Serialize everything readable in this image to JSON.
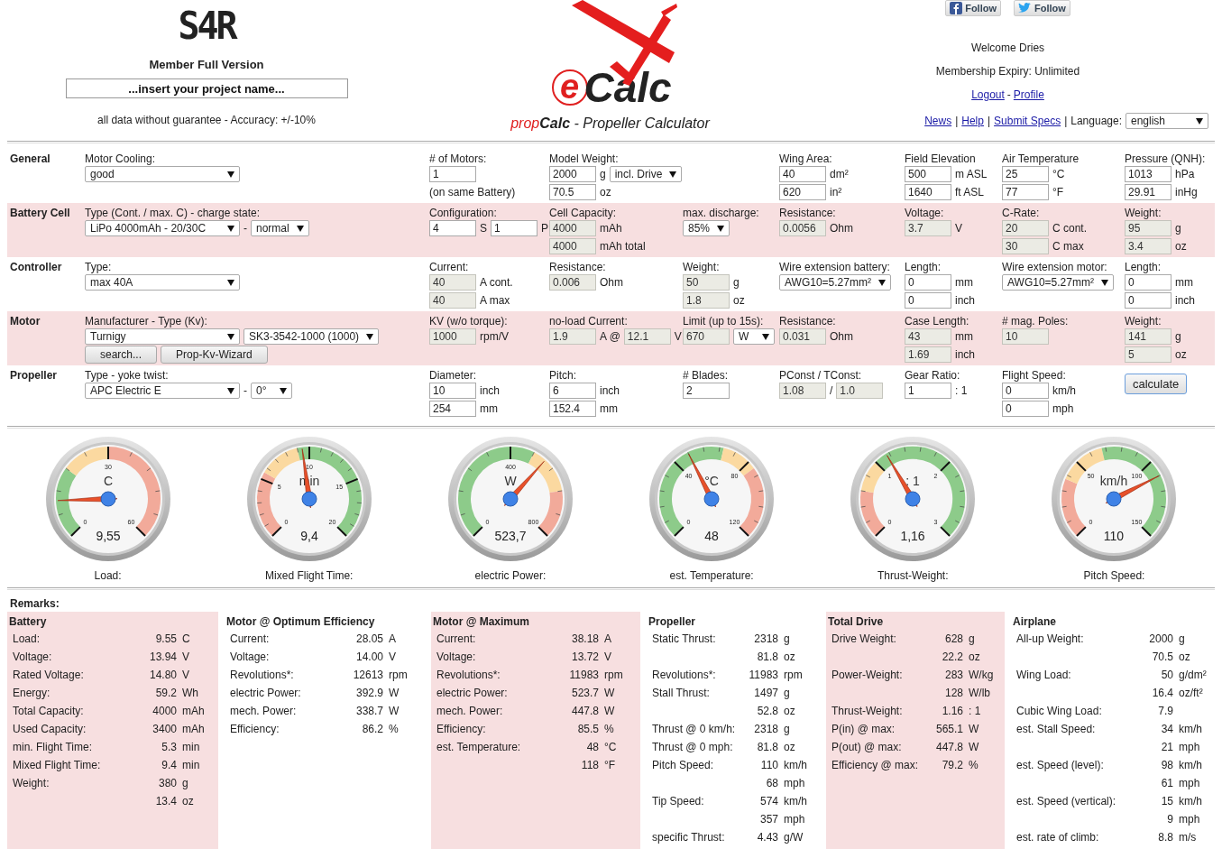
{
  "header": {
    "badge": "S4R",
    "edition": "Member Full Version",
    "project_name": {
      "value": "...insert your project name..."
    },
    "disclaimer": "all data without guarantee - Accuracy: +/-10%",
    "logo": {
      "letter": "e",
      "word": "Calc"
    },
    "subtitle": {
      "prefix": "prop",
      "brand": "Calc",
      "rest": " - Propeller Calculator"
    },
    "social": [
      {
        "kind": "facebook",
        "label": "Follow"
      },
      {
        "kind": "twitter",
        "label": "Follow"
      }
    ],
    "welcome": "Welcome Dries",
    "membership": "Membership Expiry: Unlimited",
    "account_links": [
      {
        "label": "Logout",
        "separator": "-"
      },
      {
        "label": "Profile"
      }
    ],
    "nav_links": [
      {
        "label": "News",
        "separator": "|"
      },
      {
        "label": "Help",
        "separator": "|"
      },
      {
        "label": "Submit Specs",
        "separator": "|"
      }
    ],
    "language": {
      "label": "Language:",
      "value": "english"
    }
  },
  "form": {
    "sections": [
      {
        "title": "General",
        "shaded": false,
        "fields": [
          {
            "label": "Motor Cooling:",
            "lines": [
              [
                {
                  "kind": "select",
                  "value": "good"
                }
              ]
            ]
          },
          {
            "label": "# of Motors:",
            "lines": [
              [
                {
                  "kind": "input",
                  "value": "1",
                  "readonly": false
                }
              ],
              [
                {
                  "kind": "note",
                  "text": "(on same Battery)"
                }
              ]
            ]
          },
          {
            "label": "Model Weight:",
            "lines": [
              [
                {
                  "kind": "input",
                  "value": "2000",
                  "readonly": false
                },
                {
                  "kind": "unit",
                  "text": "g"
                },
                {
                  "kind": "select",
                  "value": "incl. Drive"
                }
              ],
              [
                {
                  "kind": "input",
                  "value": "70.5",
                  "readonly": false
                },
                {
                  "kind": "unit",
                  "text": "oz"
                }
              ]
            ]
          },
          {
            "label": "Wing Area:",
            "lines": [
              [
                {
                  "kind": "input",
                  "value": "40",
                  "readonly": false
                },
                {
                  "kind": "unit",
                  "text": "dm²"
                }
              ],
              [
                {
                  "kind": "input",
                  "value": "620",
                  "readonly": false
                },
                {
                  "kind": "unit",
                  "text": "in²"
                }
              ]
            ]
          },
          {
            "label": "Field Elevation",
            "lines": [
              [
                {
                  "kind": "input",
                  "value": "500",
                  "readonly": false
                },
                {
                  "kind": "unit",
                  "text": "m ASL"
                }
              ],
              [
                {
                  "kind": "input",
                  "value": "1640",
                  "readonly": false
                },
                {
                  "kind": "unit",
                  "text": "ft ASL"
                }
              ]
            ]
          },
          {
            "label": "Air Temperature",
            "lines": [
              [
                {
                  "kind": "input",
                  "value": "25",
                  "readonly": false
                },
                {
                  "kind": "unit",
                  "text": "°C"
                }
              ],
              [
                {
                  "kind": "input",
                  "value": "77",
                  "readonly": false
                },
                {
                  "kind": "unit",
                  "text": "°F"
                }
              ]
            ]
          },
          {
            "label": "Pressure (QNH):",
            "lines": [
              [
                {
                  "kind": "input",
                  "value": "1013",
                  "readonly": false
                },
                {
                  "kind": "unit",
                  "text": "hPa"
                }
              ],
              [
                {
                  "kind": "input",
                  "value": "29.91",
                  "readonly": false
                },
                {
                  "kind": "unit",
                  "text": "inHg"
                }
              ]
            ]
          }
        ]
      },
      {
        "title": "Battery Cell",
        "shaded": true,
        "fields": [
          {
            "label": "Type (Cont. / max. C) - charge state:",
            "lines": [
              [
                {
                  "kind": "select",
                  "value": "LiPo 4000mAh - 20/30C"
                },
                {
                  "kind": "unit",
                  "text": "-"
                },
                {
                  "kind": "select",
                  "value": "normal"
                }
              ]
            ]
          },
          {
            "label": "Configuration:",
            "lines": [
              [
                {
                  "kind": "input",
                  "value": "4",
                  "readonly": false
                },
                {
                  "kind": "unit",
                  "text": "S"
                },
                {
                  "kind": "input",
                  "value": "1",
                  "readonly": false
                },
                {
                  "kind": "unit",
                  "text": "P"
                }
              ]
            ]
          },
          {
            "label": "Cell Capacity:",
            "lines": [
              [
                {
                  "kind": "input",
                  "value": "4000",
                  "readonly": true
                },
                {
                  "kind": "unit",
                  "text": "mAh"
                }
              ],
              [
                {
                  "kind": "input",
                  "value": "4000",
                  "readonly": true
                },
                {
                  "kind": "unit",
                  "text": "mAh total"
                }
              ]
            ]
          },
          {
            "label": "max. discharge:",
            "lines": [
              [
                {
                  "kind": "select",
                  "value": "85%"
                }
              ]
            ]
          },
          {
            "label": "Resistance:",
            "lines": [
              [
                {
                  "kind": "input",
                  "value": "0.0056",
                  "readonly": true
                },
                {
                  "kind": "unit",
                  "text": "Ohm"
                }
              ]
            ]
          },
          {
            "label": "Voltage:",
            "lines": [
              [
                {
                  "kind": "input",
                  "value": "3.7",
                  "readonly": true
                },
                {
                  "kind": "unit",
                  "text": "V"
                }
              ]
            ]
          },
          {
            "label": "C-Rate:",
            "lines": [
              [
                {
                  "kind": "input",
                  "value": "20",
                  "readonly": true
                },
                {
                  "kind": "unit",
                  "text": "C cont."
                }
              ],
              [
                {
                  "kind": "input",
                  "value": "30",
                  "readonly": true
                },
                {
                  "kind": "unit",
                  "text": "C max"
                }
              ]
            ]
          },
          {
            "label": "Weight:",
            "lines": [
              [
                {
                  "kind": "input",
                  "value": "95",
                  "readonly": true
                },
                {
                  "kind": "unit",
                  "text": "g"
                }
              ],
              [
                {
                  "kind": "input",
                  "value": "3.4",
                  "readonly": true
                },
                {
                  "kind": "unit",
                  "text": "oz"
                }
              ]
            ]
          }
        ]
      },
      {
        "title": "Controller",
        "shaded": false,
        "fields": [
          {
            "label": "Type:",
            "lines": [
              [
                {
                  "kind": "select",
                  "value": "max 40A"
                }
              ]
            ]
          },
          {
            "label": "Current:",
            "lines": [
              [
                {
                  "kind": "input",
                  "value": "40",
                  "readonly": true
                },
                {
                  "kind": "unit",
                  "text": "A cont."
                }
              ],
              [
                {
                  "kind": "input",
                  "value": "40",
                  "readonly": true
                },
                {
                  "kind": "unit",
                  "text": "A max"
                }
              ]
            ]
          },
          {
            "label": "Resistance:",
            "lines": [
              [
                {
                  "kind": "input",
                  "value": "0.006",
                  "readonly": true
                },
                {
                  "kind": "unit",
                  "text": "Ohm"
                }
              ]
            ]
          },
          {
            "label": "Weight:",
            "lines": [
              [
                {
                  "kind": "input",
                  "value": "50",
                  "readonly": true
                },
                {
                  "kind": "unit",
                  "text": "g"
                }
              ],
              [
                {
                  "kind": "input",
                  "value": "1.8",
                  "readonly": true
                },
                {
                  "kind": "unit",
                  "text": "oz"
                }
              ]
            ]
          },
          {
            "label": "Wire extension battery:",
            "lines": [
              [
                {
                  "kind": "select",
                  "value": "AWG10=5.27mm²"
                }
              ]
            ]
          },
          {
            "label": "Length:",
            "lines": [
              [
                {
                  "kind": "input",
                  "value": "0",
                  "readonly": false
                },
                {
                  "kind": "unit",
                  "text": "mm"
                }
              ],
              [
                {
                  "kind": "input",
                  "value": "0",
                  "readonly": false
                },
                {
                  "kind": "unit",
                  "text": "inch"
                }
              ]
            ]
          },
          {
            "label": "Wire extension motor:",
            "lines": [
              [
                {
                  "kind": "select",
                  "value": "AWG10=5.27mm²"
                }
              ]
            ]
          },
          {
            "label": "Length:",
            "lines": [
              [
                {
                  "kind": "input",
                  "value": "0",
                  "readonly": false
                },
                {
                  "kind": "unit",
                  "text": "mm"
                }
              ],
              [
                {
                  "kind": "input",
                  "value": "0",
                  "readonly": false
                },
                {
                  "kind": "unit",
                  "text": "inch"
                }
              ]
            ]
          }
        ]
      },
      {
        "title": "Motor",
        "shaded": true,
        "fields": [
          {
            "label": "Manufacturer - Type (Kv):",
            "lines": [
              [
                {
                  "kind": "select",
                  "value": "Turnigy"
                },
                {
                  "kind": "select",
                  "value": "SK3-3542-1000 (1000)"
                }
              ],
              [
                {
                  "kind": "button",
                  "label": "search..."
                },
                {
                  "kind": "button",
                  "label": "Prop-Kv-Wizard"
                }
              ]
            ]
          },
          {
            "label": "KV (w/o torque):",
            "lines": [
              [
                {
                  "kind": "input",
                  "value": "1000",
                  "readonly": true
                },
                {
                  "kind": "unit",
                  "text": "rpm/V"
                }
              ]
            ]
          },
          {
            "label": "no-load Current:",
            "lines": [
              [
                {
                  "kind": "input",
                  "value": "1.9",
                  "readonly": true
                },
                {
                  "kind": "unit",
                  "text": "A @"
                },
                {
                  "kind": "input",
                  "value": "12.1",
                  "readonly": true
                },
                {
                  "kind": "unit",
                  "text": "V"
                }
              ]
            ]
          },
          {
            "label": "Limit (up to 15s):",
            "lines": [
              [
                {
                  "kind": "input",
                  "value": "670",
                  "readonly": true
                },
                {
                  "kind": "select",
                  "value": "W"
                }
              ]
            ]
          },
          {
            "label": "Resistance:",
            "lines": [
              [
                {
                  "kind": "input",
                  "value": "0.031",
                  "readonly": true
                },
                {
                  "kind": "unit",
                  "text": "Ohm"
                }
              ]
            ]
          },
          {
            "label": "Case Length:",
            "lines": [
              [
                {
                  "kind": "input",
                  "value": "43",
                  "readonly": true
                },
                {
                  "kind": "unit",
                  "text": "mm"
                }
              ],
              [
                {
                  "kind": "input",
                  "value": "1.69",
                  "readonly": true
                },
                {
                  "kind": "unit",
                  "text": "inch"
                }
              ]
            ]
          },
          {
            "label": "# mag. Poles:",
            "lines": [
              [
                {
                  "kind": "input",
                  "value": "10",
                  "readonly": true
                }
              ]
            ]
          },
          {
            "label": "Weight:",
            "lines": [
              [
                {
                  "kind": "input",
                  "value": "141",
                  "readonly": true
                },
                {
                  "kind": "unit",
                  "text": "g"
                }
              ],
              [
                {
                  "kind": "input",
                  "value": "5",
                  "readonly": true
                },
                {
                  "kind": "unit",
                  "text": "oz"
                }
              ]
            ]
          }
        ]
      },
      {
        "title": "Propeller",
        "shaded": false,
        "fields": [
          {
            "label": "Type - yoke twist:",
            "lines": [
              [
                {
                  "kind": "select",
                  "value": "APC Electric E"
                },
                {
                  "kind": "unit",
                  "text": "-"
                },
                {
                  "kind": "select",
                  "value": "0°"
                }
              ]
            ]
          },
          {
            "label": "Diameter:",
            "lines": [
              [
                {
                  "kind": "input",
                  "value": "10",
                  "readonly": false
                },
                {
                  "kind": "unit",
                  "text": "inch"
                }
              ],
              [
                {
                  "kind": "input",
                  "value": "254",
                  "readonly": false
                },
                {
                  "kind": "unit",
                  "text": "mm"
                }
              ]
            ]
          },
          {
            "label": "Pitch:",
            "lines": [
              [
                {
                  "kind": "input",
                  "value": "6",
                  "readonly": false
                },
                {
                  "kind": "unit",
                  "text": "inch"
                }
              ],
              [
                {
                  "kind": "input",
                  "value": "152.4",
                  "readonly": false
                },
                {
                  "kind": "unit",
                  "text": "mm"
                }
              ]
            ]
          },
          {
            "label": "# Blades:",
            "lines": [
              [
                {
                  "kind": "input",
                  "value": "2",
                  "readonly": false
                }
              ]
            ]
          },
          {
            "label": "PConst / TConst:",
            "lines": [
              [
                {
                  "kind": "input",
                  "value": "1.08",
                  "readonly": true
                },
                {
                  "kind": "unit",
                  "text": "/"
                },
                {
                  "kind": "input",
                  "value": "1.0",
                  "readonly": true
                }
              ]
            ]
          },
          {
            "label": "Gear Ratio:",
            "lines": [
              [
                {
                  "kind": "input",
                  "value": "1",
                  "readonly": false
                },
                {
                  "kind": "unit",
                  "text": ": 1"
                }
              ]
            ]
          },
          {
            "label": "Flight Speed:",
            "lines": [
              [
                {
                  "kind": "input",
                  "value": "0",
                  "readonly": false
                },
                {
                  "kind": "unit",
                  "text": "km/h"
                }
              ],
              [
                {
                  "kind": "input",
                  "value": "0",
                  "readonly": false
                },
                {
                  "kind": "unit",
                  "text": "mph"
                }
              ]
            ]
          },
          {
            "lines": [
              [
                {
                  "kind": "primary_button",
                  "label": "calculate"
                }
              ]
            ]
          }
        ]
      }
    ]
  },
  "gauges": [
    {
      "label": "Load:",
      "unit": "C",
      "reading": "9,55",
      "level": 0.16,
      "ticks": [
        "30",
        "0",
        "60"
      ],
      "zones": [
        {
          "color": "#8dcb8a"
        },
        {
          "color": "#fbd9a0"
        },
        {
          "color": "#f2aa9a"
        }
      ]
    },
    {
      "label": "Mixed Flight Time:",
      "unit": "min",
      "reading": "9,4",
      "level": 0.47,
      "ticks": [
        "10",
        "5",
        "15",
        "0",
        "20"
      ],
      "zones": [
        {
          "color": "#f2aa9a"
        },
        {
          "color": "#fbd9a0"
        },
        {
          "color": "#8dcb8a"
        }
      ]
    },
    {
      "label": "electric Power:",
      "unit": "W",
      "reading": "523,7",
      "level": 0.655,
      "ticks": [
        "400",
        "0",
        "800"
      ],
      "zones": [
        {
          "color": "#8dcb8a"
        },
        {
          "color": "#fbd9a0"
        },
        {
          "color": "#f2aa9a"
        }
      ]
    },
    {
      "label": "est. Temperature:",
      "unit": "°C",
      "reading": "48",
      "level": 0.4,
      "ticks": [
        "40",
        "80",
        "0",
        "120"
      ],
      "zones": [
        {
          "color": "#8dcb8a"
        },
        {
          "color": "#fbd9a0"
        },
        {
          "color": "#f2aa9a"
        }
      ]
    },
    {
      "label": "Thrust-Weight:",
      "unit": ": 1",
      "reading": "1,16",
      "level": 0.387,
      "ticks": [
        "1",
        "2",
        "0",
        "3"
      ],
      "zones": [
        {
          "color": "#f2aa9a"
        },
        {
          "color": "#fbd9a0"
        },
        {
          "color": "#8dcb8a"
        }
      ]
    },
    {
      "label": "Pitch Speed:",
      "unit": "km/h",
      "reading": "110",
      "level": 0.733,
      "ticks": [
        "50",
        "100",
        "0",
        "150"
      ],
      "zones": [
        {
          "color": "#f2aa9a"
        },
        {
          "color": "#fbd9a0"
        },
        {
          "color": "#8dcb8a"
        }
      ]
    }
  ],
  "remarks": {
    "title": "Remarks:",
    "columns": [
      {
        "title": "Battery",
        "shaded": true,
        "rows": [
          {
            "label": "Load:",
            "value": "9.55",
            "unit": "C"
          },
          {
            "label": "Voltage:",
            "value": "13.94",
            "unit": "V"
          },
          {
            "label": "Rated Voltage:",
            "value": "14.80",
            "unit": "V"
          },
          {
            "label": "Energy:",
            "value": "59.2",
            "unit": "Wh"
          },
          {
            "label": "Total Capacity:",
            "value": "4000",
            "unit": "mAh"
          },
          {
            "label": "Used Capacity:",
            "value": "3400",
            "unit": "mAh"
          },
          {
            "label": "min. Flight Time:",
            "value": "5.3",
            "unit": "min"
          },
          {
            "label": "Mixed Flight Time:",
            "value": "9.4",
            "unit": "min"
          },
          {
            "label": "Weight:",
            "value": "380",
            "unit": "g"
          },
          {
            "value": "13.4",
            "unit": "oz"
          }
        ]
      },
      {
        "title": "Motor @ Optimum Efficiency",
        "shaded": false,
        "rows": [
          {
            "label": "Current:",
            "value": "28.05",
            "unit": "A"
          },
          {
            "label": "Voltage:",
            "value": "14.00",
            "unit": "V"
          },
          {
            "label": "Revolutions*:",
            "value": "12613",
            "unit": "rpm"
          },
          {
            "label": "electric Power:",
            "value": "392.9",
            "unit": "W"
          },
          {
            "label": "mech. Power:",
            "value": "338.7",
            "unit": "W"
          },
          {
            "label": "Efficiency:",
            "value": "86.2",
            "unit": "%"
          }
        ]
      },
      {
        "title": "Motor @ Maximum",
        "shaded": true,
        "rows": [
          {
            "label": "Current:",
            "value": "38.18",
            "unit": "A"
          },
          {
            "label": "Voltage:",
            "value": "13.72",
            "unit": "V"
          },
          {
            "label": "Revolutions*:",
            "value": "11983",
            "unit": "rpm"
          },
          {
            "label": "electric Power:",
            "value": "523.7",
            "unit": "W"
          },
          {
            "label": "mech. Power:",
            "value": "447.8",
            "unit": "W"
          },
          {
            "label": "Efficiency:",
            "value": "85.5",
            "unit": "%"
          },
          {
            "label": "est. Temperature:",
            "value": "48",
            "unit": "°C"
          },
          {
            "value": "118",
            "unit": "°F"
          }
        ]
      },
      {
        "title": "Propeller",
        "shaded": false,
        "rows": [
          {
            "label": "Static Thrust:",
            "value": "2318",
            "unit": "g"
          },
          {
            "value": "81.8",
            "unit": "oz"
          },
          {
            "label": "Revolutions*:",
            "value": "11983",
            "unit": "rpm"
          },
          {
            "label": "Stall Thrust:",
            "value": "1497",
            "unit": "g"
          },
          {
            "value": "52.8",
            "unit": "oz"
          },
          {
            "label": "Thrust @ 0 km/h:",
            "value": "2318",
            "unit": "g"
          },
          {
            "label": "Thrust @ 0 mph:",
            "value": "81.8",
            "unit": "oz"
          },
          {
            "label": "Pitch Speed:",
            "value": "110",
            "unit": "km/h"
          },
          {
            "value": "68",
            "unit": "mph"
          },
          {
            "label": "Tip Speed:",
            "value": "574",
            "unit": "km/h"
          },
          {
            "value": "357",
            "unit": "mph"
          },
          {
            "label": "specific Thrust:",
            "value": "4.43",
            "unit": "g/W"
          }
        ]
      },
      {
        "title": "Total Drive",
        "shaded": true,
        "rows": [
          {
            "label": "Drive Weight:",
            "value": "628",
            "unit": "g"
          },
          {
            "value": "22.2",
            "unit": "oz"
          },
          {
            "label": "Power-Weight:",
            "value": "283",
            "unit": "W/kg"
          },
          {
            "value": "128",
            "unit": "W/lb"
          },
          {
            "label": "Thrust-Weight:",
            "value": "1.16",
            "unit": ": 1"
          },
          {
            "label": "P(in) @ max:",
            "value": "565.1",
            "unit": "W"
          },
          {
            "label": "P(out) @ max:",
            "value": "447.8",
            "unit": "W"
          },
          {
            "label": "Efficiency @ max:",
            "value": "79.2",
            "unit": "%"
          }
        ]
      },
      {
        "title": "Airplane",
        "shaded": false,
        "rows": [
          {
            "label": "All-up Weight:",
            "value": "2000",
            "unit": "g"
          },
          {
            "value": "70.5",
            "unit": "oz"
          },
          {
            "label": "Wing Load:",
            "value": "50",
            "unit": "g/dm²"
          },
          {
            "value": "16.4",
            "unit": "oz/ft²"
          },
          {
            "label": "Cubic Wing Load:",
            "value": "7.9"
          },
          {
            "label": "est. Stall Speed:",
            "value": "34",
            "unit": "km/h"
          },
          {
            "value": "21",
            "unit": "mph"
          },
          {
            "label": "est. Speed (level):",
            "value": "98",
            "unit": "km/h"
          },
          {
            "value": "61",
            "unit": "mph"
          },
          {
            "label": "est. Speed (vertical):",
            "value": "15",
            "unit": "km/h"
          },
          {
            "value": "9",
            "unit": "mph"
          },
          {
            "label": "est. rate of climb:",
            "value": "8.8",
            "unit": "m/s"
          }
        ]
      }
    ]
  }
}
